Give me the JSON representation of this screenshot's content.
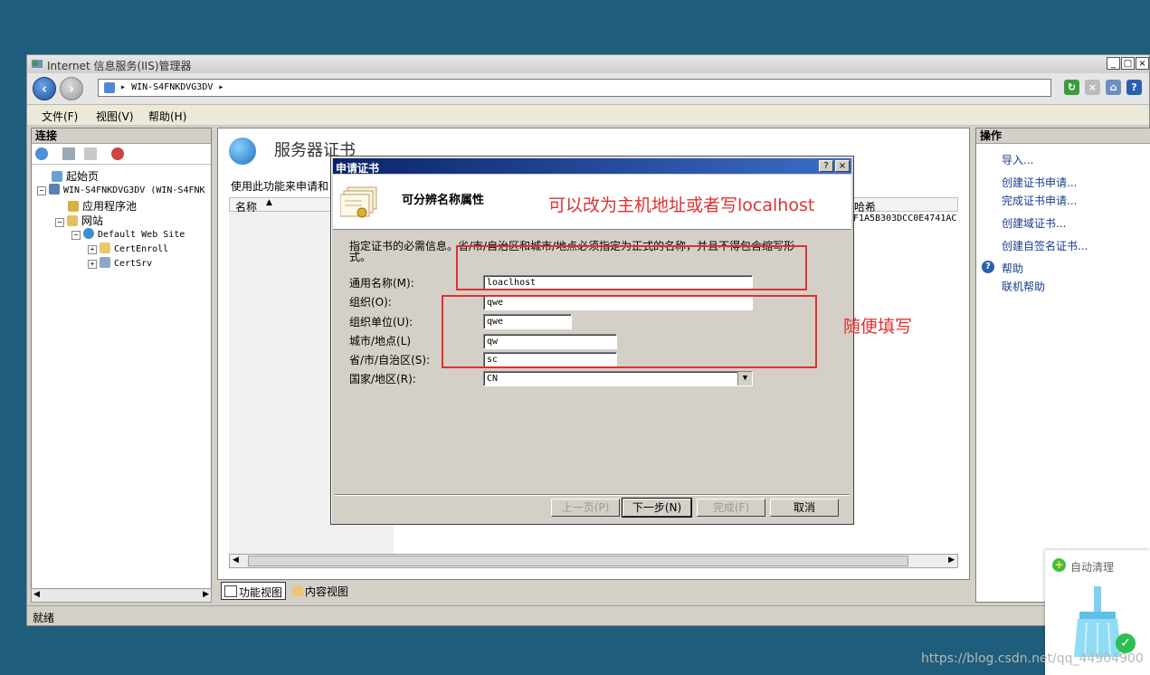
{
  "window": {
    "title": "Internet 信息服务(IIS)管理器",
    "controls": [
      "_",
      "□",
      "×"
    ]
  },
  "address": {
    "path": "WIN-S4FNKDVG3DV",
    "sep": "▸"
  },
  "menu": {
    "file": "文件(F)",
    "view": "视图(V)",
    "help": "帮助(H)"
  },
  "left": {
    "header": "连接",
    "tree": {
      "start": "起始页",
      "server": "WIN-S4FNKDVG3DV (WIN-S4FNK",
      "apppool": "应用程序池",
      "sites": "网站",
      "default_site": "Default Web Site",
      "certenroll": "CertEnroll",
      "certsrv": "CertSrv"
    }
  },
  "center": {
    "title": "服务器证书",
    "desc": "使用此功能来申请和",
    "col_name": "名称",
    "col_right": "哈希",
    "hash_fragment": "F1A5B303DCC0E4741AC",
    "tab_feature": "功能视图",
    "tab_content": "内容视图"
  },
  "right": {
    "header": "操作",
    "actions": [
      "导入...",
      "创建证书申请...",
      "完成证书申请...",
      "创建域证书...",
      "创建自签名证书..."
    ],
    "help": "帮助",
    "online_help": "联机帮助"
  },
  "status": "就绪",
  "dialog": {
    "title": "申请证书",
    "heading": "可分辨名称属性",
    "instruction": "指定证书的必需信息。省/市/自治区和城市/地点必须指定为正式的名称，并且不得包含缩写形式。",
    "fields": [
      {
        "label": "通用名称(M):",
        "value": "loaclhost"
      },
      {
        "label": "组织(O):",
        "value": "qwe"
      },
      {
        "label": "组织单位(U):",
        "value": "qwe"
      },
      {
        "label": "城市/地点(L)",
        "value": "qw"
      },
      {
        "label": "省/市/自治区(S):",
        "value": "sc"
      },
      {
        "label": "国家/地区(R):",
        "value": "CN"
      }
    ],
    "buttons": {
      "prev": "上一页(P)",
      "next": "下一步(N)",
      "finish": "完成(F)",
      "cancel": "取消"
    },
    "help_btn": "?",
    "close_btn": "×"
  },
  "annotations": {
    "note1": "可以改为主机地址或者写localhost",
    "note2": "随便填写"
  },
  "cleaner": {
    "label": "自动清理"
  },
  "watermark": "https://blog.csdn.net/qq_44904900",
  "colors": {
    "desktop": "#1e5d7b",
    "annotation": "#e03030",
    "dialog_title": "#0a246a"
  }
}
